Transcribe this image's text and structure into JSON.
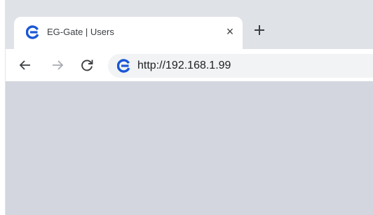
{
  "tab": {
    "title": "EG-Gate | Users",
    "close_glyph": "×",
    "favicon": "eg-gate-logo-icon"
  },
  "new_tab_icon": "plus-icon",
  "toolbar": {
    "back_icon": "arrow-left-icon",
    "forward_icon": "arrow-right-icon",
    "reload_icon": "reload-icon"
  },
  "address_bar": {
    "url": "http://192.168.1.99",
    "site_icon": "eg-gate-logo-icon"
  },
  "colors": {
    "tabstrip": "#dfe2e7",
    "content": "#d3d6de",
    "logo_blue": "#1a56d6"
  }
}
